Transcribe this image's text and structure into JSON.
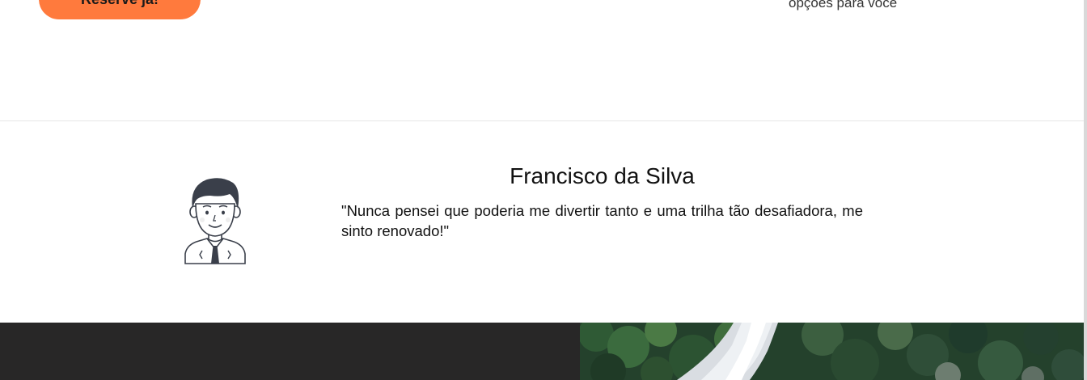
{
  "top_section": {
    "cta_label": "Reserve já!",
    "options_text": "opções para você"
  },
  "testimonial": {
    "name": "Francisco da Silva",
    "quote": "\"Nunca pensei que poderia me divertir tanto e uma trilha tão desafiadora, me sinto renovado!\"",
    "avatar_icon": "man-avatar-icon"
  },
  "colors": {
    "accent": "#ff7a3d",
    "dark_panel": "#282727",
    "divider": "#e6e6e6"
  },
  "photo": {
    "icon": "waterfall-forest-photo"
  }
}
